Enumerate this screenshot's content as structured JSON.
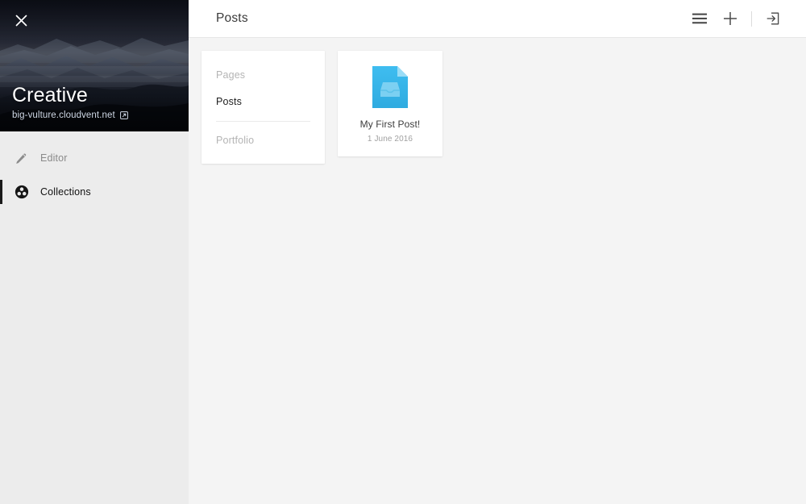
{
  "sidebar": {
    "close_icon": "close-x-icon",
    "site_title": "Creative",
    "site_url": "big-vulture.cloudvent.net",
    "external_link_icon": "external-link-icon",
    "hero_image": "dark-misty-mountains-photo",
    "nav": [
      {
        "label": "Editor",
        "icon": "pencil-icon",
        "active": false
      },
      {
        "label": "Collections",
        "icon": "collections-circles-icon",
        "active": true
      }
    ]
  },
  "topbar": {
    "title": "Posts",
    "actions": [
      {
        "name": "list-view-button",
        "icon": "hamburger-list-icon"
      },
      {
        "name": "add-button",
        "icon": "plus-icon"
      },
      {
        "name": "logout-button",
        "icon": "sign-out-arrow-box-icon"
      }
    ]
  },
  "collections": {
    "items": [
      {
        "label": "Pages",
        "selected": false
      },
      {
        "label": "Posts",
        "selected": true
      },
      {
        "label": "Portfolio",
        "selected": false
      }
    ]
  },
  "posts": [
    {
      "title": "My First Post!",
      "date": "1 June 2016",
      "icon": "blue-document-inbox-icon"
    }
  ],
  "colors": {
    "sidebar_bg": "#ececec",
    "main_bg": "#f4f4f4",
    "card_bg": "#ffffff",
    "accent_black": "#1a1a1a",
    "doc_blue": "#35b7ec",
    "doc_blue_light": "#6fcdf2",
    "muted_text": "#b4b4b4",
    "url_text": "#cfd8e6"
  }
}
